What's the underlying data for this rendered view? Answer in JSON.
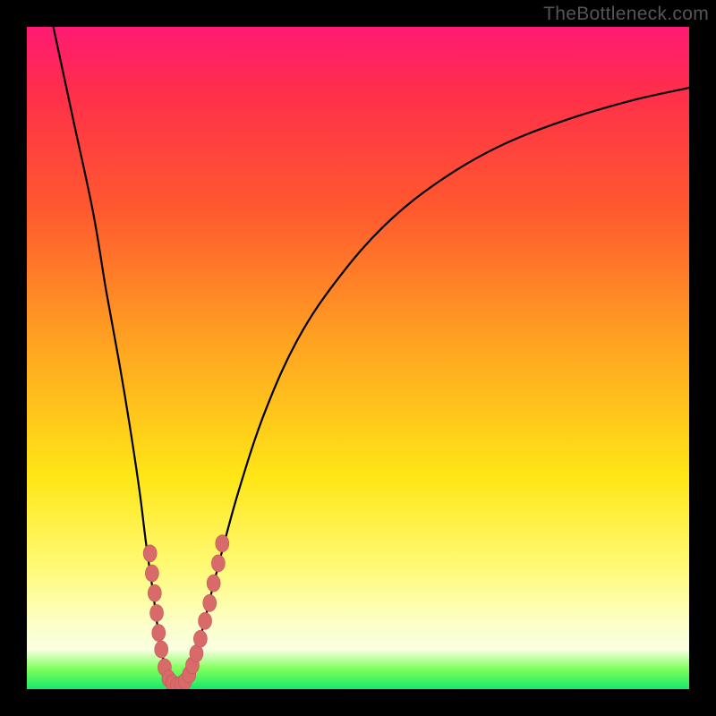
{
  "watermark": "TheBottleneck.com",
  "colors": {
    "frame": "#000000",
    "curve_stroke": "#000000",
    "marker_fill": "#d86a6a",
    "marker_stroke": "#c25757",
    "gradient_stops": [
      "#ff1a74",
      "#ff2f4a",
      "#ff5a2e",
      "#ffa421",
      "#ffe616",
      "#fffb7a",
      "#fdffc7",
      "#faffe1",
      "#7dff5a",
      "#17e86b"
    ]
  },
  "chart_data": {
    "type": "line",
    "title": "",
    "xlabel": "",
    "ylabel": "",
    "xlim": [
      0,
      100
    ],
    "ylim": [
      0,
      100
    ],
    "curve_xy": [
      [
        4,
        100
      ],
      [
        7,
        86
      ],
      [
        10,
        72
      ],
      [
        12,
        60
      ],
      [
        14,
        49
      ],
      [
        15.5,
        40
      ],
      [
        17,
        30
      ],
      [
        18,
        22
      ],
      [
        19,
        15
      ],
      [
        19.8,
        9
      ],
      [
        20.5,
        5
      ],
      [
        21.2,
        2.3
      ],
      [
        22,
        0.9
      ],
      [
        22.8,
        0.5
      ],
      [
        23.7,
        0.9
      ],
      [
        24.6,
        2.3
      ],
      [
        25.5,
        5
      ],
      [
        27,
        11
      ],
      [
        29,
        19
      ],
      [
        32,
        30
      ],
      [
        36,
        42
      ],
      [
        41,
        53
      ],
      [
        47,
        62
      ],
      [
        54,
        70
      ],
      [
        62,
        76.5
      ],
      [
        71,
        81.8
      ],
      [
        81,
        85.8
      ],
      [
        91,
        88.8
      ],
      [
        100,
        90.8
      ]
    ],
    "markers_xy": [
      [
        18.6,
        20.5
      ],
      [
        18.9,
        17.5
      ],
      [
        19.3,
        14.5
      ],
      [
        19.6,
        11.5
      ],
      [
        19.9,
        8.5
      ],
      [
        20.3,
        6.0
      ],
      [
        20.8,
        3.3
      ],
      [
        21.4,
        1.6
      ],
      [
        22.0,
        0.9
      ],
      [
        22.7,
        0.5
      ],
      [
        23.3,
        0.7
      ],
      [
        23.9,
        1.2
      ],
      [
        24.5,
        2.2
      ],
      [
        25.0,
        3.6
      ],
      [
        25.6,
        5.4
      ],
      [
        26.2,
        7.6
      ],
      [
        26.9,
        10.3
      ],
      [
        27.6,
        13.0
      ],
      [
        28.2,
        16.0
      ],
      [
        28.9,
        19.0
      ],
      [
        29.5,
        22.0
      ]
    ]
  }
}
